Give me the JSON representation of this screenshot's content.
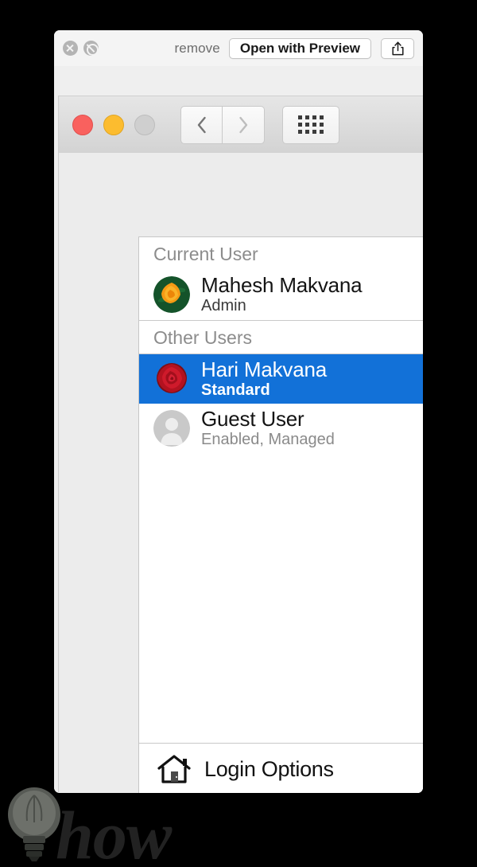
{
  "quicklook": {
    "badges": [
      {
        "name": "close-badge",
        "glyph": "x-in-circle"
      },
      {
        "name": "block-badge",
        "glyph": "slash-in-circle"
      }
    ],
    "remove_label": "remove",
    "open_button_label": "Open with Preview",
    "share_icon": "share-icon"
  },
  "screenshot": {
    "window_controls": [
      {
        "name": "close",
        "color": "#f9615e"
      },
      {
        "name": "minimize",
        "color": "#fcbc2f"
      },
      {
        "name": "zoom",
        "color": "#cfcfcf"
      }
    ],
    "nav": {
      "back_icon": "chevron-left-icon",
      "forward_icon": "chevron-right-icon",
      "grid_icon": "grid-dots-icon"
    },
    "users_pane": {
      "sections": [
        {
          "header": "Current User",
          "users": [
            {
              "name": "Mahesh Makvana",
              "status": "Admin",
              "avatar": "poppy-flower-avatar",
              "selected": false,
              "muted_status": false
            }
          ]
        },
        {
          "header": "Other Users",
          "users": [
            {
              "name": "Hari Makvana",
              "status": "Standard",
              "avatar": "red-rose-avatar",
              "selected": true,
              "muted_status": false
            },
            {
              "name": "Guest User",
              "status": "Enabled, Managed",
              "avatar": "person-silhouette-avatar",
              "selected": false,
              "muted_status": true
            }
          ]
        }
      ],
      "login_options": {
        "label": "Login Options",
        "icon": "home-icon"
      },
      "toolbar": {
        "add_label": "+",
        "remove_label": "−",
        "settings_icon": "gear-icon"
      }
    },
    "selection_color": "#1271d8"
  },
  "watermark": {
    "text": "how",
    "icon": "lightbulb-icon"
  }
}
